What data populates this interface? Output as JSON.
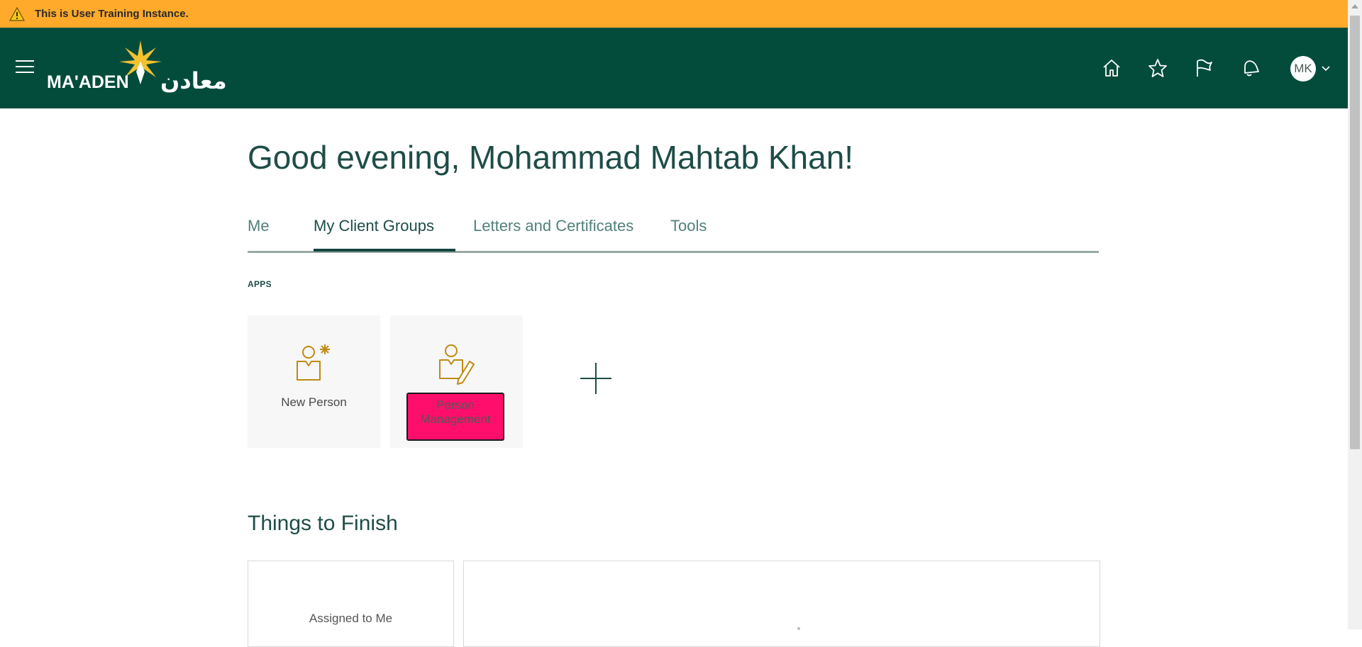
{
  "banner": {
    "text": "This is User Training Instance."
  },
  "header": {
    "logo_latin": "MA'ADEN",
    "logo_arabic": "معادن",
    "avatar_initials": "MK"
  },
  "greeting": "Good evening, Mohammad Mahtab Khan!",
  "tabs": [
    {
      "label": "Me",
      "active": false
    },
    {
      "label": "My Client Groups",
      "active": true
    },
    {
      "label": "Letters and Certificates",
      "active": false
    },
    {
      "label": "Tools",
      "active": false
    }
  ],
  "apps": {
    "section_label": "APPS",
    "items": [
      {
        "label": "New Person",
        "icon": "new-person-icon"
      },
      {
        "label": "Person Management",
        "icon": "person-management-icon"
      }
    ]
  },
  "things_to_finish": {
    "title": "Things to Finish",
    "assigned_label": "Assigned to Me"
  },
  "colors": {
    "banner": "#ffaa2b",
    "header": "#034c3c",
    "accent_text": "#1e4d47",
    "icon_gold": "#c08a12",
    "highlight": "#ff0f6b"
  }
}
